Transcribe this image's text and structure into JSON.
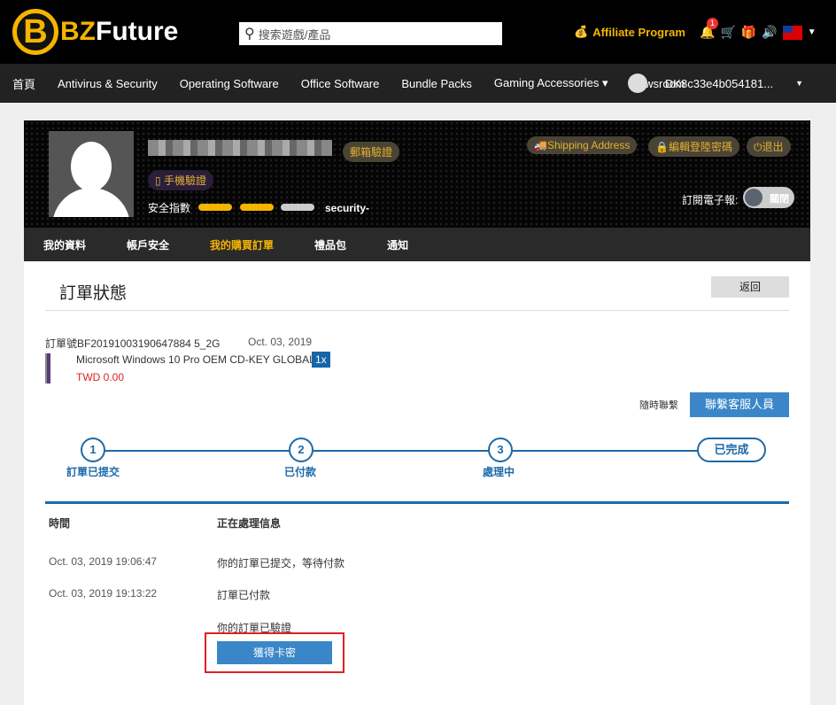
{
  "header": {
    "logo_b": "B",
    "logo_bz": "BZ",
    "logo_future": "Future",
    "search_placeholder": "搜索遊戲/產品",
    "affiliate": "Affiliate Program",
    "notif_count": "1"
  },
  "nav": {
    "items": [
      "首頁",
      "Antivirus & Security",
      "Operating Software",
      "Office Software",
      "Bundle Packs",
      "Gaming Accessories ▾",
      "Newsroom"
    ],
    "user": "DK8c33e4b054181..."
  },
  "profile": {
    "email_verify": "郵箱驗證",
    "phone_verify": "手機驗證",
    "security_label": "安全指數",
    "security_text": "security-",
    "shipping": "Shipping Address",
    "edit_password": "編輯登陸密碼",
    "logout": "退出",
    "newsletter_label": "訂閱電子報:",
    "newsletter_state": "關閉"
  },
  "tabs": [
    "我的資料",
    "帳戶安全",
    "我的購買訂單",
    "禮品包",
    "通知"
  ],
  "order": {
    "title": "訂單狀態",
    "back": "返回",
    "number": "訂單號 BF20191003190647884 5_2G",
    "date": "Oct. 03, 2019",
    "product": "Microsoft Windows 10 Pro OEM CD-KEY GLOBAL",
    "qty": "1x",
    "price": "TWD 0.00",
    "contact_label": "隨時聯繫",
    "contact_button": "聯繫客服人員"
  },
  "steps": [
    {
      "n": "1",
      "label": "訂單已提交"
    },
    {
      "n": "2",
      "label": "已付款"
    },
    {
      "n": "3",
      "label": "處理中"
    },
    {
      "label": "已完成"
    }
  ],
  "log": {
    "col_time": "時間",
    "col_info": "正在處理信息",
    "rows": [
      {
        "time": "Oct. 03, 2019 19:06:47",
        "info": "你的訂單已提交，等待付款"
      },
      {
        "time": "Oct. 03, 2019 19:13:22",
        "info": "訂單已付款"
      },
      {
        "time": "",
        "info": "你的訂單已驗證"
      }
    ],
    "get_key": "獲得卡密"
  }
}
